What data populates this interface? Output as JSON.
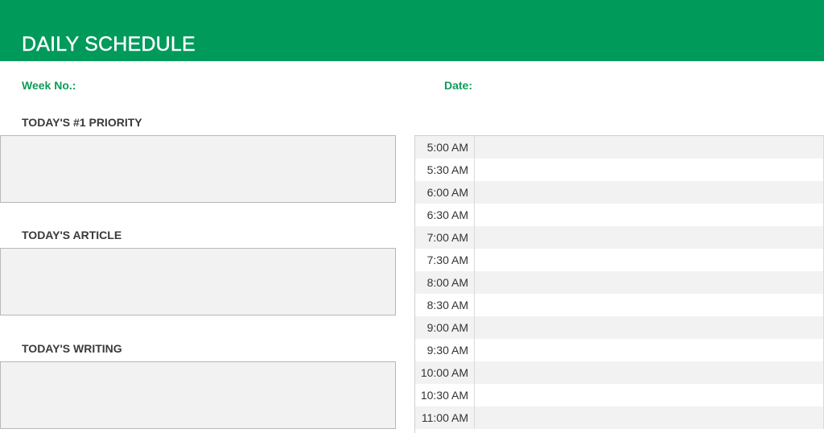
{
  "header": {
    "title": "DAILY SCHEDULE",
    "accent_color": "#009a5b"
  },
  "fields": {
    "week_label": "Week No.:",
    "date_label": "Date:"
  },
  "sections": [
    {
      "label": "TODAY'S #1 PRIORITY",
      "value": ""
    },
    {
      "label": "TODAY'S ARTICLE",
      "value": ""
    },
    {
      "label": "TODAY'S WRITING",
      "value": ""
    }
  ],
  "schedule": {
    "slots": [
      {
        "time": "5:00 AM",
        "entry": ""
      },
      {
        "time": "5:30 AM",
        "entry": ""
      },
      {
        "time": "6:00 AM",
        "entry": ""
      },
      {
        "time": "6:30 AM",
        "entry": ""
      },
      {
        "time": "7:00 AM",
        "entry": ""
      },
      {
        "time": "7:30 AM",
        "entry": ""
      },
      {
        "time": "8:00 AM",
        "entry": ""
      },
      {
        "time": "8:30 AM",
        "entry": ""
      },
      {
        "time": "9:00 AM",
        "entry": ""
      },
      {
        "time": "9:30 AM",
        "entry": ""
      },
      {
        "time": "10:00 AM",
        "entry": ""
      },
      {
        "time": "10:30 AM",
        "entry": ""
      },
      {
        "time": "11:00 AM",
        "entry": ""
      }
    ]
  }
}
